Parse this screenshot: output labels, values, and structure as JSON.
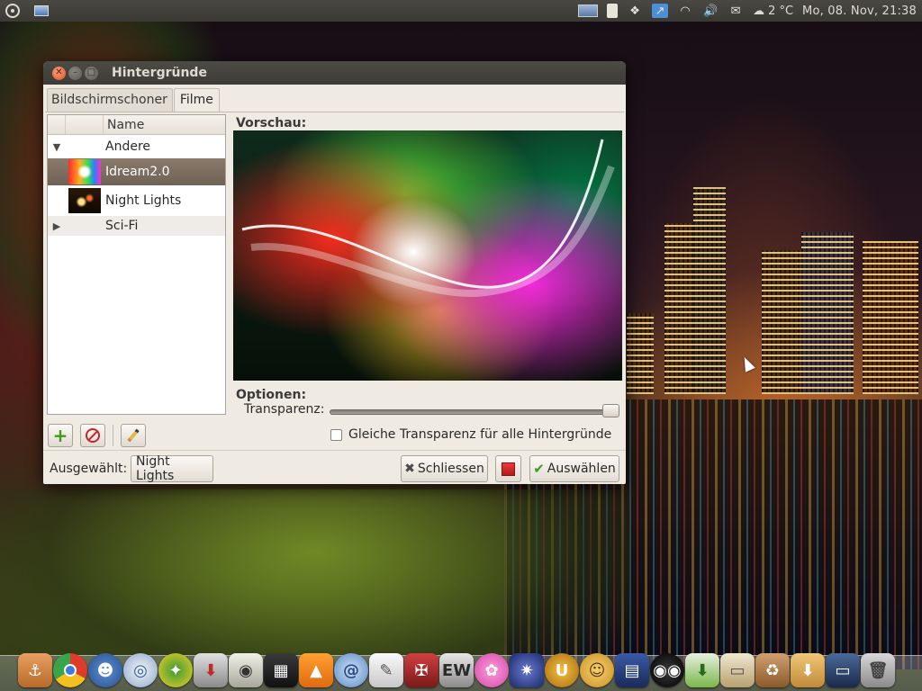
{
  "top_panel": {
    "weather": "2 °C",
    "clock": "Mo, 08. Nov, 21:38",
    "tray_icons": [
      "display-icon",
      "usb-icon",
      "dropbox-icon",
      "update-icon",
      "wifi-icon",
      "volume-icon",
      "mail-icon",
      "weather-icon"
    ]
  },
  "window": {
    "title": "Hintergründe",
    "tabs": [
      {
        "label": "Bildschirmschoner",
        "active": false
      },
      {
        "label": "Filme",
        "active": true
      }
    ],
    "tree": {
      "column_name": "Name",
      "rows": [
        {
          "label": "Andere",
          "expander": "▼",
          "thumbnail": null,
          "selected": false
        },
        {
          "label": "Idream2.0",
          "expander": "",
          "thumbnail": "idream",
          "selected": true
        },
        {
          "label": "Night Lights",
          "expander": "",
          "thumbnail": "night",
          "selected": false
        },
        {
          "label": "Sci-Fi",
          "expander": "▶",
          "thumbnail": null,
          "selected": false
        }
      ]
    },
    "preview_label": "Vorschau:",
    "options_label": "Optionen:",
    "transparency_label": "Transparenz:",
    "transparency_value": 1.0,
    "same_transparency_label": "Gleiche Transparenz für alle Hintergründe",
    "same_transparency_checked": false,
    "selected_label": "Ausgewählt:",
    "selected_value": "Night Lights",
    "close_button": "Schliessen",
    "choose_button": "Auswählen"
  },
  "colors": {
    "panel_bg": "#3c3b37",
    "window_bg": "#f0ebe2",
    "selection": "#7a6c5e",
    "close_button": "#e0502a"
  }
}
